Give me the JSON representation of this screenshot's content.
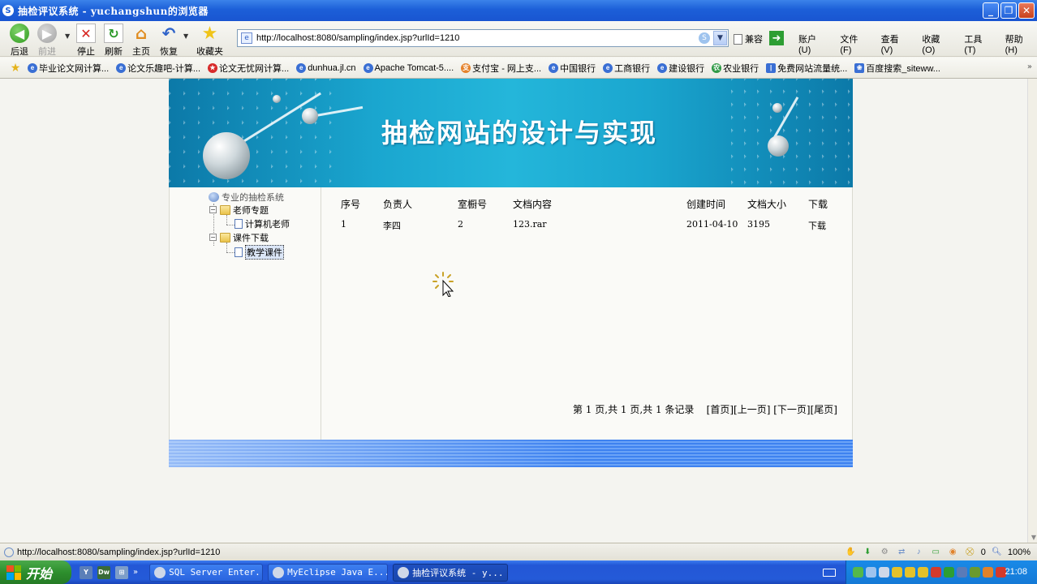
{
  "window": {
    "title": "抽检评议系统 - yuchangshun的浏览器"
  },
  "toolbar": {
    "back": "后退",
    "forward": "前进",
    "stop": "停止",
    "refresh": "刷新",
    "home": "主页",
    "restore": "恢复",
    "favorites": "收藏夹",
    "address": "http://localhost:8080/sampling/index.jsp?urlId=1210",
    "compat": "兼容",
    "menus": [
      "账户 (U)",
      "文件 (F)",
      "查看 (V)",
      "收藏 (O)",
      "工具 (T)",
      "帮助 (H)"
    ]
  },
  "favbar": {
    "items": [
      "毕业论文网计算...",
      "论文乐趣吧-计算...",
      "论文无忧网计算...",
      "dunhua.jl.cn",
      "Apache Tomcat-5....",
      "支付宝 - 网上支...",
      "中国银行",
      "工商银行",
      "建设银行",
      "农业银行",
      "免费网站流量统...",
      "百度搜索_siteww..."
    ]
  },
  "site": {
    "heading": "抽检网站的设计与实现",
    "tree": {
      "root": "专业的抽检系统",
      "group1": "老师专题",
      "group1_child": "计算机老师",
      "group2": "课件下载",
      "group2_child": "教学课件"
    },
    "table": {
      "headers": [
        "序号",
        "负责人",
        "室橱号",
        "文档内容",
        "创建时间",
        "文档大小",
        "下载"
      ],
      "rows": [
        [
          "1",
          "李四",
          "2",
          "123.rar",
          "2011-04-10",
          "3195",
          "下载"
        ]
      ]
    },
    "pager": {
      "summary": "第 1 页,共 1 页,共 1 条记录",
      "first": "[首页]",
      "prev": "[上一页]",
      "next": "[下一页]",
      "last": "[尾页]"
    }
  },
  "statusbar": {
    "url": "http://localhost:8080/sampling/index.jsp?urlId=1210",
    "count": "0",
    "zoom": "100%"
  },
  "taskbar": {
    "start": "开始",
    "tasks": [
      "SQL Server Enter...",
      "MyEclipse Java E...",
      "抽检评议系统 - y..."
    ],
    "clock": "21:08"
  },
  "colors": {
    "titlebar": "#1c5fd8",
    "banner": "#1aa6cf",
    "footer": "#3e82f0"
  }
}
